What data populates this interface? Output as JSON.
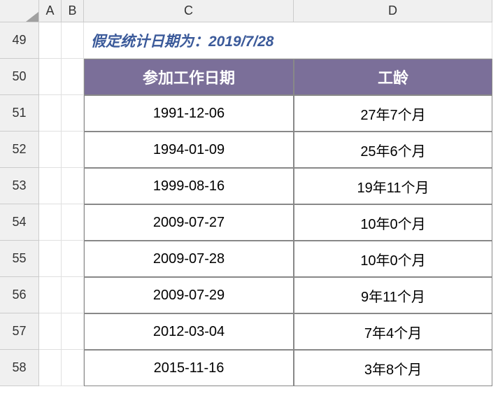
{
  "columns": [
    "A",
    "B",
    "C",
    "D"
  ],
  "row_numbers": [
    "49",
    "50",
    "51",
    "52",
    "53",
    "54",
    "55",
    "56",
    "57",
    "58"
  ],
  "announcement": "假定统计日期为：2019/7/28",
  "headers": {
    "date": "参加工作日期",
    "tenure": "工龄"
  },
  "chart_data": {
    "type": "table",
    "title": "假定统计日期为：2019/7/28",
    "columns": [
      "参加工作日期",
      "工龄"
    ],
    "rows": [
      {
        "date": "1991-12-06",
        "tenure": "27年7个月"
      },
      {
        "date": "1994-01-09",
        "tenure": "25年6个月"
      },
      {
        "date": "1999-08-16",
        "tenure": "19年11个月"
      },
      {
        "date": "2009-07-27",
        "tenure": "10年0个月"
      },
      {
        "date": "2009-07-28",
        "tenure": "10年0个月"
      },
      {
        "date": "2009-07-29",
        "tenure": "9年11个月"
      },
      {
        "date": "2012-03-04",
        "tenure": "7年4个月"
      },
      {
        "date": "2015-11-16",
        "tenure": "3年8个月"
      }
    ]
  }
}
